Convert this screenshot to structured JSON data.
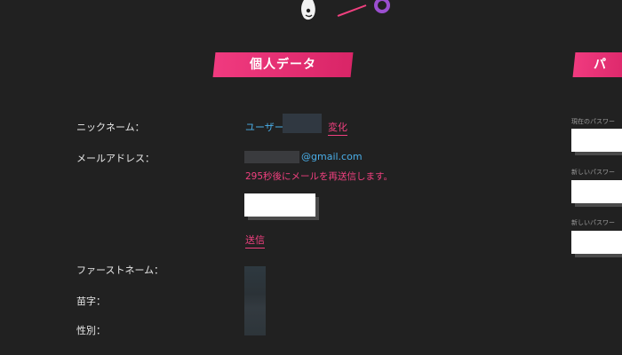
{
  "colors": {
    "background": "#212121",
    "accent_pink": "#f0407f",
    "link_blue": "#4aaee8"
  },
  "personal": {
    "title": "個人データ",
    "nickname_label": "ニックネーム：",
    "nickname_prefix": "ユーザー",
    "change_label": "変化",
    "email_label": "メールアドレス：",
    "email_domain": "@gmail.com",
    "resend_message": "295秒後にメールを再送信します。",
    "send_label": "送信",
    "first_name_label": "ファーストネーム：",
    "last_name_label": "苗字：",
    "gender_label": "性別："
  },
  "password": {
    "title": "パ",
    "current_label": "現在のパスワー",
    "new_label": "新しいパスワー",
    "confirm_label": "新しいパスワー"
  }
}
